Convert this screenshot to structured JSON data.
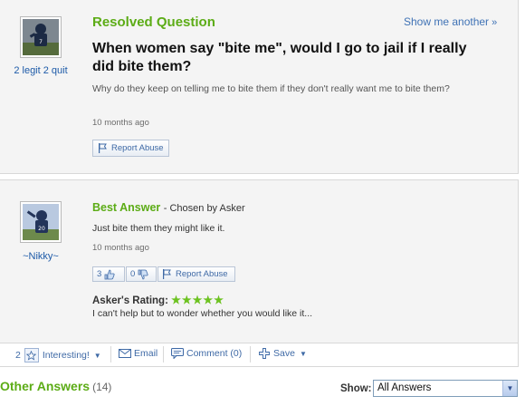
{
  "question": {
    "status": "Resolved Question",
    "show_another": "Show me another",
    "show_another_chevron": "»",
    "title": "When women say \"bite me\", would I go to jail if I really did bite them?",
    "body": "Why do they keep on telling me to bite them if they don't really want me to bite them?",
    "time": "10 months ago",
    "report_label": "Report Abuse",
    "asker_name": "2 legit 2 quit"
  },
  "best_answer": {
    "heading": "Best Answer",
    "chosen": "- Chosen by Asker",
    "text": "Just bite them they might like it.",
    "time": "10 months ago",
    "thumbs_up_count": "3",
    "thumbs_down_count": "0",
    "report_label": "Report Abuse",
    "answerer_name": "~Nikky~",
    "rating_label": "Asker's Rating:",
    "rating_stars": "★★★★★",
    "rating_value": 5,
    "rating_comment": "I can't help but to wonder whether you would like it..."
  },
  "toolbar": {
    "star_count": "2",
    "interesting": "Interesting!",
    "email": "Email",
    "comment": "Comment (0)",
    "save": "Save"
  },
  "other_answers": {
    "label": "Other Answers",
    "count": "(14)",
    "show_label": "Show:",
    "show_value": "All Answers"
  },
  "colors": {
    "accent_green": "#5cac16",
    "link_blue": "#3f72b5",
    "panel_bg": "#f4f4f4"
  }
}
